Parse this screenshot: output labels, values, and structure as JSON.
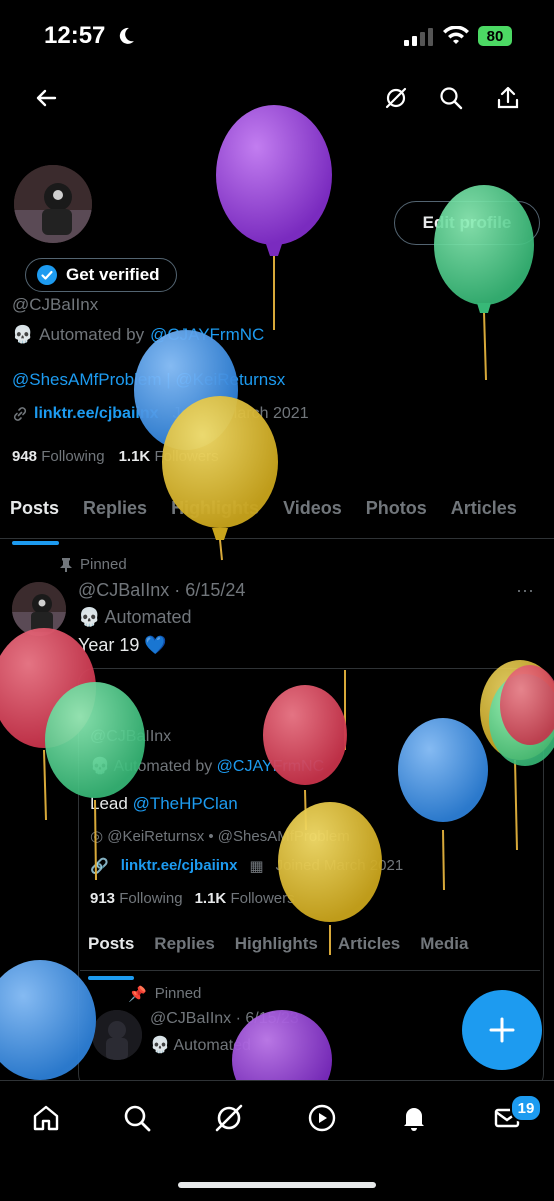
{
  "status_bar": {
    "time": "12:57",
    "battery": "80"
  },
  "header": {
    "back_icon": "arrow-left-icon",
    "grok_icon": "grok-icon",
    "search_icon": "search-icon",
    "share_icon": "share-icon"
  },
  "profile": {
    "edit_label": "Edit profile",
    "verify_label": "Get verified",
    "handle": "@CJBaIInx",
    "automated_prefix": "Automated by",
    "automated_link": "@CJAYFrmNC",
    "bio_links": "@ShesAMfProblem | @KeiReturnsx",
    "website": "linktr.ee/cjbaiinx",
    "joined": "Joined March 2021",
    "following_count": "948",
    "following_label": "Following",
    "followers_count": "1.1K",
    "followers_label": "Followers"
  },
  "tabs": [
    {
      "label": "Posts"
    },
    {
      "label": "Replies"
    },
    {
      "label": "Highlights"
    },
    {
      "label": "Videos"
    },
    {
      "label": "Photos"
    },
    {
      "label": "Articles"
    }
  ],
  "post": {
    "pinned_label": "Pinned",
    "handle_date": "@CJBaIInx · 6/15/24",
    "automated": "Automated",
    "text": "Year 19 💙",
    "more": "···"
  },
  "embed": {
    "handle": "@CJBaIInx",
    "automated_prefix": "Automated by",
    "automated_link": "@CJAYFrmNC",
    "lead_prefix": "Lead",
    "lead_link": "@TheHPClan",
    "mentions": "@KeiReturnsx • @ShesAMfProblem",
    "website": "linktr.ee/cjbaiinx",
    "joined": "Joined March 2021",
    "following_count": "913",
    "following_label": "Following",
    "followers_count": "1.1K",
    "followers_label": "Followers",
    "tabs": [
      "Posts",
      "Replies",
      "Highlights",
      "Articles",
      "Media"
    ],
    "pinned_label": "Pinned",
    "post_handle_date": "@CJBaIInx · 6/15/23",
    "post_automated": "Automated"
  },
  "bottom_nav": {
    "items": [
      "home-icon",
      "search-icon",
      "grok-icon",
      "video-icon",
      "notifications-icon",
      "messages-icon"
    ],
    "messages_badge": "19"
  },
  "colors": {
    "accent": "#1d9bf0",
    "background": "#000000",
    "muted": "#71767b"
  }
}
